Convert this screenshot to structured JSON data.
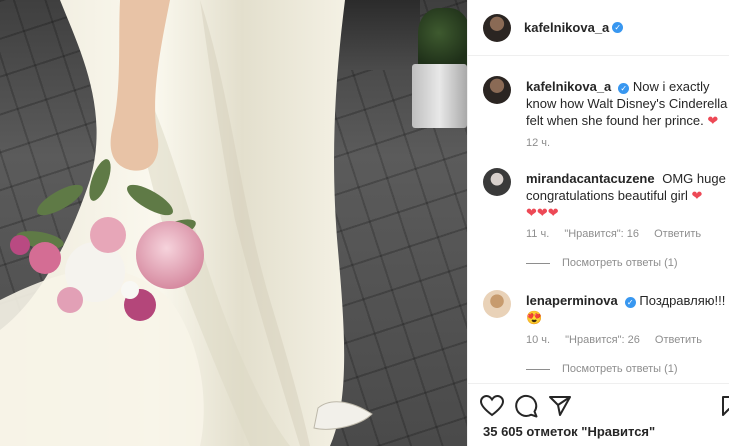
{
  "post": {
    "author": "kafelnikova_a",
    "verified": true,
    "caption": "Now i exactly know how Walt Disney's Cinderella felt when she found her prince. ❤️",
    "caption_text": "Now i exactly know how Walt Disney's Cinderella felt when she found her prince.",
    "time": "12 ч."
  },
  "comments": [
    {
      "username": "mirandacantacuzene",
      "verified": false,
      "text": "OMG huge congratulations beautiful girl",
      "emoji_line": "❤❤❤",
      "time": "11 ч.",
      "likes": "\"Нравится\": 16",
      "reply": "Ответить",
      "view_replies": "Посмотреть ответы (1)"
    },
    {
      "username": "lenaperminova",
      "verified": true,
      "text": "Поздравляю!!!",
      "emoji_line": "😍",
      "time": "10 ч.",
      "likes": "\"Нравится\": 26",
      "reply": "Ответить",
      "view_replies": "Посмотреть ответы (1)"
    }
  ],
  "actions": {
    "like_icon": "heart-outline-icon",
    "comment_icon": "comment-bubble-icon",
    "share_icon": "paper-plane-icon",
    "save_icon": "bookmark-icon"
  },
  "likes_count": "35 605 отметок \"Нравится\"",
  "colors": {
    "verified_blue": "#3897f0",
    "heart_red": "#ed4956",
    "secondary_text": "#8e8e8e",
    "border": "#efefef"
  }
}
